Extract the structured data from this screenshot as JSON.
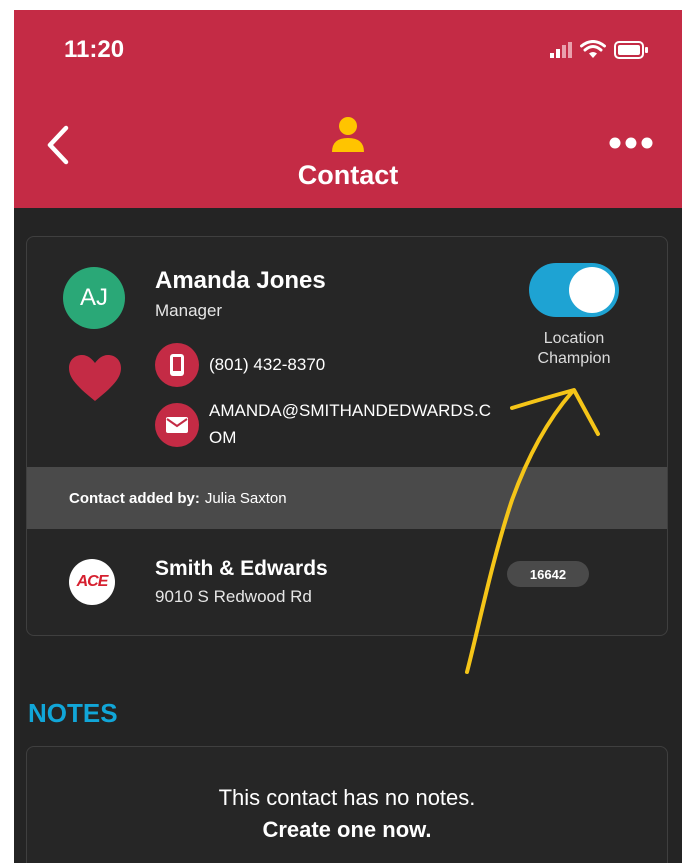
{
  "status_bar": {
    "time": "11:20"
  },
  "header": {
    "title": "Contact"
  },
  "contact": {
    "initials": "AJ",
    "name": "Amanda Jones",
    "role": "Manager",
    "phone": "(801) 432-8370",
    "email": "AMANDA@SMITHANDEDWARDS.COM",
    "toggle_label": "Location Champion",
    "toggle_on": true
  },
  "added_by": {
    "label": "Contact added by:",
    "value": "Julia Saxton"
  },
  "store": {
    "logo_text": "ACE",
    "name": "Smith & Edwards",
    "address": "9010 S Redwood Rd",
    "number": "16642"
  },
  "notes": {
    "heading": "NOTES",
    "empty_text": "This contact has no notes.",
    "create_text": "Create one now."
  },
  "colors": {
    "header_red": "#c42b45",
    "background": "#242424",
    "toggle_blue": "#1ea3d3",
    "avatar_green": "#2aa877",
    "notes_blue": "#11a6d8",
    "annotation_yellow": "#f5c518"
  },
  "icons": [
    "back-chevron-icon",
    "more-dots-icon",
    "person-icon",
    "heart-icon",
    "phone-icon",
    "mail-icon",
    "signal-icon",
    "wifi-icon",
    "battery-icon"
  ]
}
